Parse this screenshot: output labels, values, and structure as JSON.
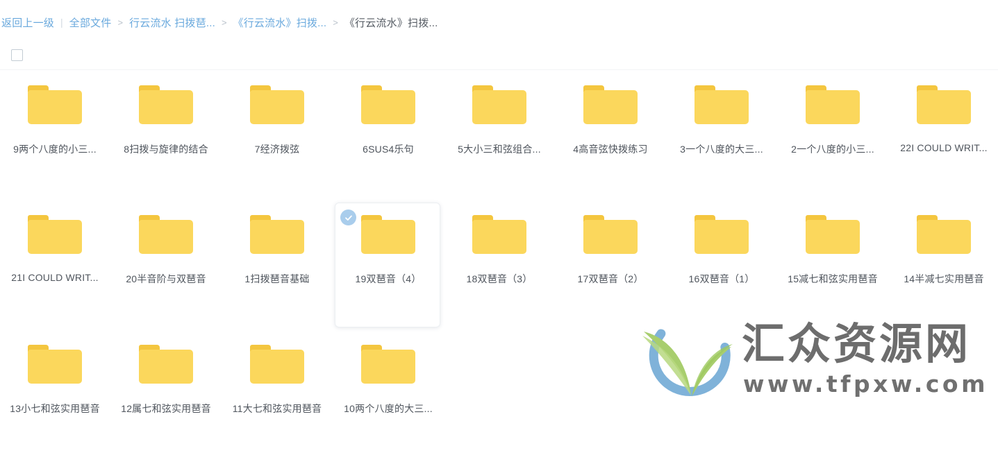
{
  "breadcrumb": {
    "back_label": "返回上一级",
    "separator": ">",
    "pipe": "|",
    "items": [
      {
        "label": "全部文件",
        "current": false
      },
      {
        "label": "行云流水 扫拨琶...",
        "current": false
      },
      {
        "label": "《行云流水》扫拨...",
        "current": false
      },
      {
        "label": "《行云流水》扫拨...",
        "current": true
      }
    ]
  },
  "toolbar": {
    "select_all_checked": false
  },
  "colors": {
    "link": "#6aa9dd",
    "current_crumb": "#555b63",
    "folder_body": "#fbd75c",
    "folder_tab": "#f4c63f",
    "check_badge": "#a9cdec",
    "label_text": "#4f555d",
    "watermark_blue": "#7fb2d9",
    "watermark_green": "#a8ce6e",
    "watermark_gray": "#6d6d6d"
  },
  "grid": {
    "rows": [
      [
        {
          "name": "9两个八度的小三...",
          "icon": "folder-icon",
          "selected": false
        },
        {
          "name": "8扫拨与旋律的结合",
          "icon": "folder-icon",
          "selected": false
        },
        {
          "name": "7经济拨弦",
          "icon": "folder-icon",
          "selected": false
        },
        {
          "name": "6SUS4乐句",
          "icon": "folder-icon",
          "selected": false
        },
        {
          "name": "5大小三和弦组合...",
          "icon": "folder-icon",
          "selected": false
        },
        {
          "name": "4高音弦快拨练习",
          "icon": "folder-icon",
          "selected": false
        },
        {
          "name": "3一个八度的大三...",
          "icon": "folder-icon",
          "selected": false
        },
        {
          "name": "2一个八度的小三...",
          "icon": "folder-icon",
          "selected": false
        },
        {
          "name": "22I COULD WRIT...",
          "icon": "folder-icon",
          "selected": false
        }
      ],
      [
        {
          "name": "21I COULD WRIT...",
          "icon": "folder-icon",
          "selected": false
        },
        {
          "name": "20半音阶与双琶音",
          "icon": "folder-icon",
          "selected": false
        },
        {
          "name": "1扫拨琶音基础",
          "icon": "folder-icon",
          "selected": false
        },
        {
          "name": "19双琶音（4）",
          "icon": "folder-icon",
          "selected": true
        },
        {
          "name": "18双琶音（3）",
          "icon": "folder-icon",
          "selected": false
        },
        {
          "name": "17双琶音（2）",
          "icon": "folder-icon",
          "selected": false
        },
        {
          "name": "16双琶音（1）",
          "icon": "folder-icon",
          "selected": false
        },
        {
          "name": "15减七和弦实用琶音",
          "icon": "folder-icon",
          "selected": false
        },
        {
          "name": "14半减七实用琶音",
          "icon": "folder-icon",
          "selected": false
        }
      ],
      [
        {
          "name": "13小七和弦实用琶音",
          "icon": "folder-icon",
          "selected": false
        },
        {
          "name": "12属七和弦实用琶音",
          "icon": "folder-icon",
          "selected": false
        },
        {
          "name": "11大七和弦实用琶音",
          "icon": "folder-icon",
          "selected": false
        },
        {
          "name": "10两个八度的大三...",
          "icon": "folder-icon",
          "selected": false
        }
      ]
    ]
  },
  "watermark": {
    "brand_cn": "汇众资源网",
    "url": "www.tfpxw.com",
    "mark_name": "leaf-circle-logo"
  }
}
